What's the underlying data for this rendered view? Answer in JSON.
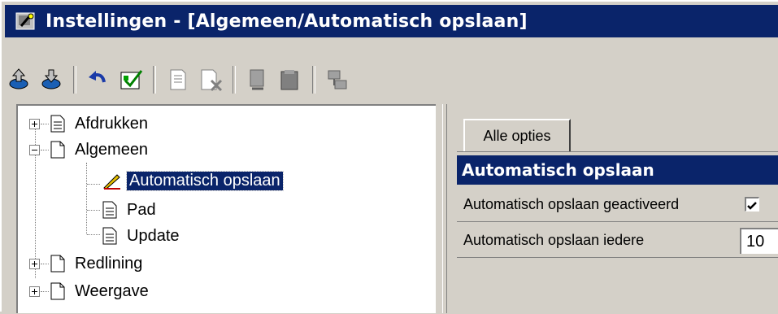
{
  "window": {
    "title": "Instellingen - [Algemeen/Automatisch opslaan]"
  },
  "toolbar": {
    "buttons": [
      {
        "icon": "export-icon"
      },
      {
        "icon": "import-icon"
      },
      {
        "icon": "undo-icon"
      },
      {
        "icon": "apply-icon"
      },
      {
        "icon": "document-icon"
      },
      {
        "icon": "document-delete-icon"
      },
      {
        "icon": "copy-icon"
      },
      {
        "icon": "paste-icon"
      },
      {
        "icon": "network-icon"
      }
    ]
  },
  "tree": {
    "items": [
      {
        "label": "Afdrukken",
        "expanded": false
      },
      {
        "label": "Algemeen",
        "expanded": true
      },
      {
        "label": "Automatisch opslaan",
        "selected": true
      },
      {
        "label": "Pad"
      },
      {
        "label": "Update"
      },
      {
        "label": "Redlining",
        "expanded": false
      },
      {
        "label": "Weergave",
        "expanded": false
      }
    ]
  },
  "tabs": {
    "active": "Alle opties"
  },
  "grid": {
    "section_title": "Automatisch opslaan",
    "rows": [
      {
        "label": "Automatisch opslaan geactiveerd",
        "checked": true
      },
      {
        "label": "Automatisch opslaan iedere",
        "value": "10"
      }
    ]
  },
  "colors": {
    "titlebar": "#0a246a",
    "face": "#d4d0c8",
    "highlight": "#0a246a"
  }
}
